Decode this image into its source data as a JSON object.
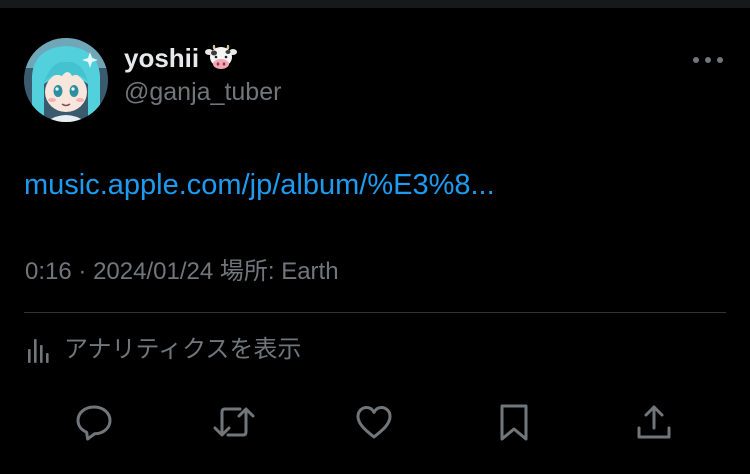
{
  "tweet": {
    "author": {
      "display_name": "yoshii",
      "name_emoji": "cow-face",
      "handle": "@ganja_tuber",
      "avatar": "anime-character-avatar"
    },
    "link_text": "music.apple.com/jp/album/%E3%8...",
    "meta": {
      "time": "0:16",
      "separator": "·",
      "date": "2024/01/24",
      "location_label": "場所: Earth"
    },
    "analytics_label": "アナリティクスを表示",
    "actions": [
      "reply-icon",
      "retweet-icon",
      "like-icon",
      "bookmark-icon",
      "share-icon"
    ],
    "more_icon": "more-horizontal-icon"
  },
  "colors": {
    "background": "#000000",
    "primary_text": "#e7e9ea",
    "secondary_text": "#71767b",
    "link": "#1d9bf0",
    "divider": "#2f3336"
  }
}
